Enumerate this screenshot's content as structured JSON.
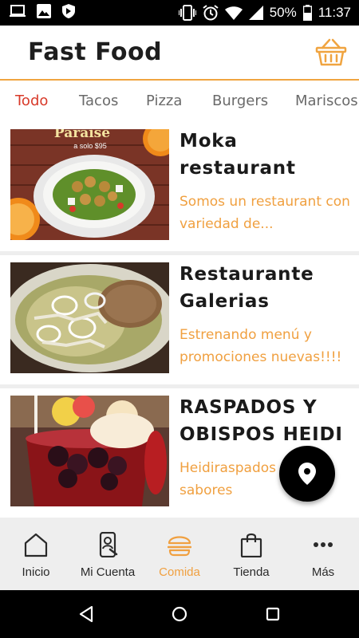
{
  "status_bar": {
    "icons_left": [
      "laptop-icon",
      "image-icon",
      "shield-icon"
    ],
    "icons_right": [
      "vibrate-icon",
      "alarm-icon",
      "wifi-icon",
      "signal-icon",
      "battery-icon"
    ],
    "battery": "50%",
    "time": "11:37"
  },
  "header": {
    "title": "Fast Food",
    "cart_icon": "basket-icon",
    "accent_color": "#f0a440"
  },
  "tabs": [
    {
      "label": "Todo",
      "active": true
    },
    {
      "label": "Tacos",
      "active": false
    },
    {
      "label": "Pizza",
      "active": false
    },
    {
      "label": "Burgers",
      "active": false
    },
    {
      "label": "Mariscos",
      "active": false
    }
  ],
  "restaurants": [
    {
      "name": "Moka restaurant",
      "description": "Somos un restaurant con variedad de...",
      "image_text": {
        "brand": "Paraise",
        "price": "a solo $95"
      }
    },
    {
      "name": "Restaurante Galerias",
      "description": "Estrenando menú y promociones nuevas!!!!"
    },
    {
      "name": "RASPADOS Y OBISPOS HEIDI",
      "description": "Heidiraspados de 16 sabores"
    }
  ],
  "fab": {
    "icon": "location-pin-icon"
  },
  "bottom_nav": [
    {
      "label": "Inicio",
      "icon": "home-icon",
      "active": false
    },
    {
      "label": "Mi Cuenta",
      "icon": "account-phone-icon",
      "active": false
    },
    {
      "label": "Comida",
      "icon": "burger-icon",
      "active": true
    },
    {
      "label": "Tienda",
      "icon": "shopping-bag-icon",
      "active": false
    },
    {
      "label": "Más",
      "icon": "more-dots-icon",
      "active": false
    }
  ],
  "system_nav": [
    "back-icon",
    "home-circle-icon",
    "recents-icon"
  ]
}
